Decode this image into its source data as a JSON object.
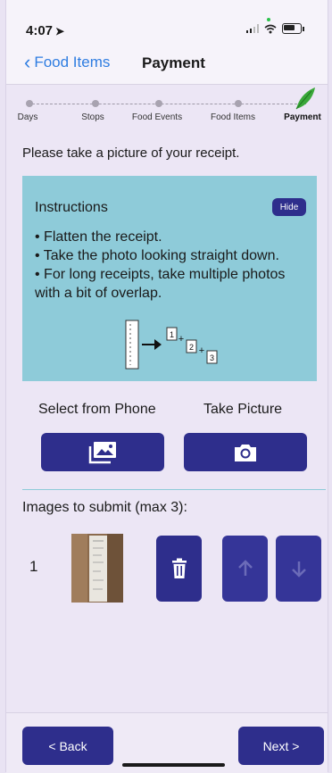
{
  "status_bar": {
    "time": "4:07",
    "location_arrow": "location-arrow-icon",
    "icons": [
      "signal-icon",
      "wifi-icon",
      "battery-icon"
    ]
  },
  "nav": {
    "back_label": "Food Items",
    "title": "Payment"
  },
  "stepper": {
    "steps": [
      "Days",
      "Stops",
      "Food Events",
      "Food Items",
      "Payment"
    ],
    "active_index": 4,
    "accent_color": "#3aa83a"
  },
  "prompt": "Please take a picture of your receipt.",
  "instructions": {
    "title": "Instructions",
    "hide_label": "Hide",
    "items": [
      "• Flatten the receipt.",
      "• Take the photo looking straight down.",
      "• For long receipts, take multiple photos with a bit of overlap."
    ],
    "diagram": {
      "numbers": [
        "1",
        "2",
        "3"
      ],
      "plus": "+"
    }
  },
  "actions": {
    "select_label": "Select from Phone",
    "take_label": "Take Picture",
    "select_icon": "photo-library-icon",
    "take_icon": "camera-icon"
  },
  "images": {
    "title": "Images to submit (max 3):",
    "rows": [
      {
        "index": "1",
        "thumbnail": "receipt-thumbnail"
      }
    ],
    "row_icons": [
      "trash-icon",
      "arrow-up-icon",
      "arrow-down-icon"
    ]
  },
  "footer": {
    "back_label": "< Back",
    "next_label": "Next >"
  },
  "colors": {
    "primary": "#2e2e8c",
    "instructions_bg": "#8ecbd9",
    "page_bg": "#ece6f5",
    "link": "#2f7de1"
  }
}
